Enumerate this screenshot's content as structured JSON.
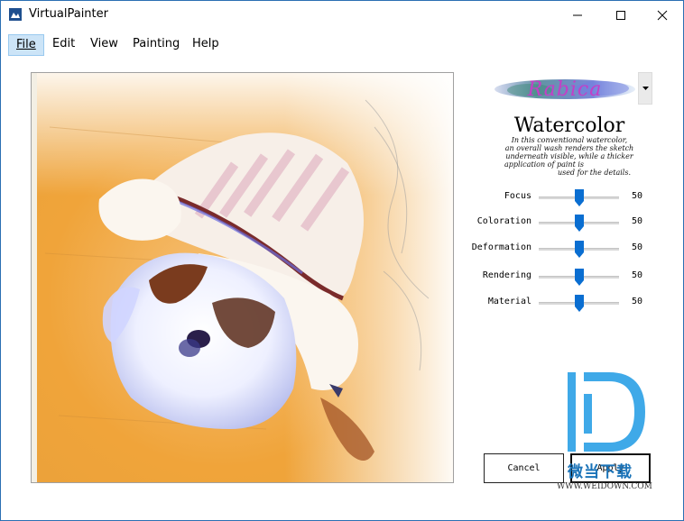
{
  "window": {
    "title": "VirtualPainter"
  },
  "menu": [
    {
      "label": "File",
      "active": true
    },
    {
      "label": "Edit",
      "active": false
    },
    {
      "label": "View",
      "active": false
    },
    {
      "label": "Painting",
      "active": false
    },
    {
      "label": "Help",
      "active": false
    }
  ],
  "panel": {
    "style_selector": {
      "selected": "Rabica"
    },
    "style_name": "Watercolor",
    "style_description": [
      "In this conventional watercolor,",
      "an overall wash renders the sketch",
      "underneath visible, while a thicker",
      "application of paint is",
      "used for the details."
    ],
    "params": [
      {
        "label": "Focus",
        "value": "50",
        "level": 0.5
      },
      {
        "label": "Coloration",
        "value": "50",
        "level": 0.5
      },
      {
        "label": "Deformation",
        "value": "50",
        "level": 0.5
      },
      {
        "label": "Rendering",
        "value": "50",
        "level": 0.5
      },
      {
        "label": "Material",
        "value": "50",
        "level": 0.5
      }
    ],
    "buttons": {
      "cancel": "Cancel",
      "apply": "Apply"
    }
  },
  "watermark": {
    "text": "微当下载",
    "url": "WWW.WEIDOWN.COM"
  },
  "colors": {
    "accent": "#0078d7",
    "thumb": "#0a6ed1",
    "menu_active": "#cce4f7",
    "brand_magenta": "#c43fc7"
  }
}
